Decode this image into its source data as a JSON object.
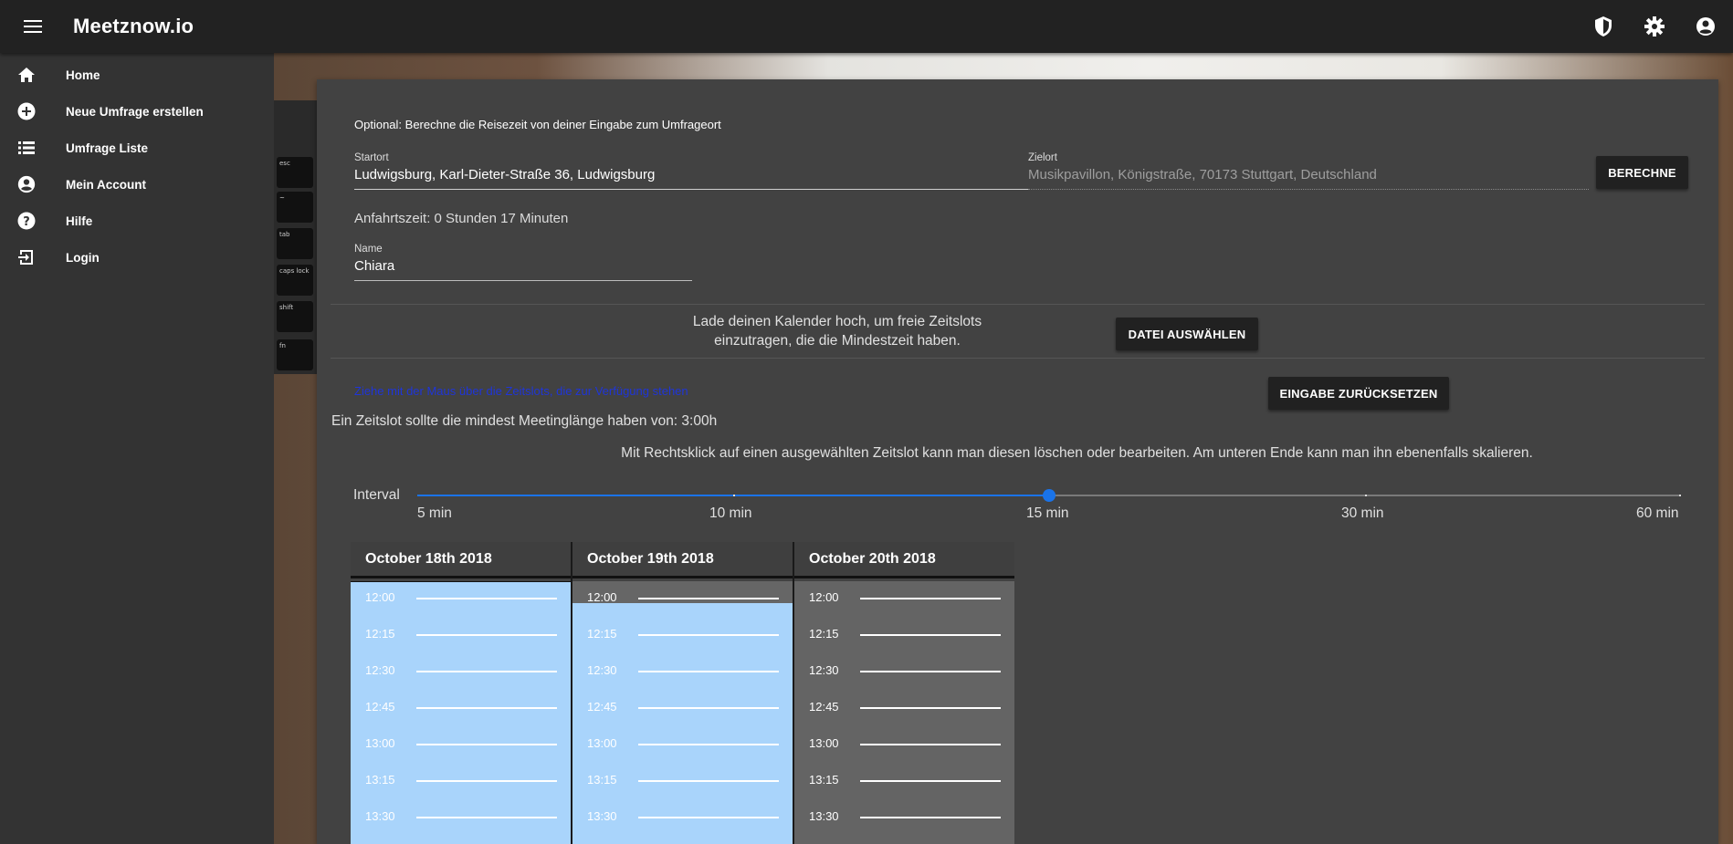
{
  "app": {
    "title": "Meetznow.io"
  },
  "topbar": {
    "icons": [
      "menu-icon",
      "shield-icon",
      "gear-icon",
      "account-icon"
    ]
  },
  "sidebar": {
    "items": [
      {
        "label": "Home",
        "icon": "home-icon"
      },
      {
        "label": "Neue Umfrage erstellen",
        "icon": "add-circle-icon"
      },
      {
        "label": "Umfrage Liste",
        "icon": "list-icon"
      },
      {
        "label": "Mein Account",
        "icon": "account-icon"
      },
      {
        "label": "Hilfe",
        "icon": "help-icon"
      },
      {
        "label": "Login",
        "icon": "login-icon"
      }
    ]
  },
  "travel": {
    "heading": "Optional: Berechne die Reisezeit von deiner Eingabe zum Umfrageort",
    "start_label": "Startort",
    "start_value": "Ludwigsburg, Karl-Dieter-Straße 36, Ludwigsburg",
    "dest_label": "Zielort",
    "dest_value": "Musikpavillon, Königstraße, 70173 Stuttgart, Deutschland",
    "calc_button": "BERECHNE",
    "result": "Anfahrtszeit: 0 Stunden 17 Minuten"
  },
  "name_field": {
    "label": "Name",
    "value": "Chiara"
  },
  "upload": {
    "text_line1": "Lade deinen Kalender hoch, um freie Zeitslots",
    "text_line2": "einzutragen, die die Mindestzeit haben.",
    "button": "DATEI AUSWÄHLEN"
  },
  "hints": {
    "drag": "Ziehe mit der Maus über die Zeitslots, die zur Verfügung stehen",
    "reset_button": "EINGABE ZURÜCKSETZEN",
    "min_length": "Ein Zeitslot sollte die mindest Meetinglänge haben von: 3:00h",
    "right_click": "Mit Rechtsklick auf einen ausgewählten Zeitslot kann man diesen löschen oder bearbeiten. Am unteren Ende kann man ihn ebenenfalls skalieren."
  },
  "interval": {
    "label": "Interval",
    "options": [
      "5 min",
      "10 min",
      "15 min",
      "30 min",
      "60 min"
    ],
    "selected_index": 2,
    "accent": "#1a73e8"
  },
  "calendar": {
    "days": [
      {
        "title": "October 18th 2018",
        "selected": true
      },
      {
        "title": "October 19th 2018",
        "selected": true
      },
      {
        "title": "October 20th 2018",
        "selected": false
      }
    ],
    "times": [
      "12:00",
      "12:15",
      "12:30",
      "12:45",
      "13:00",
      "13:15",
      "13:30"
    ],
    "selected_color": "#a9d4fb",
    "free_color": "#646464"
  }
}
